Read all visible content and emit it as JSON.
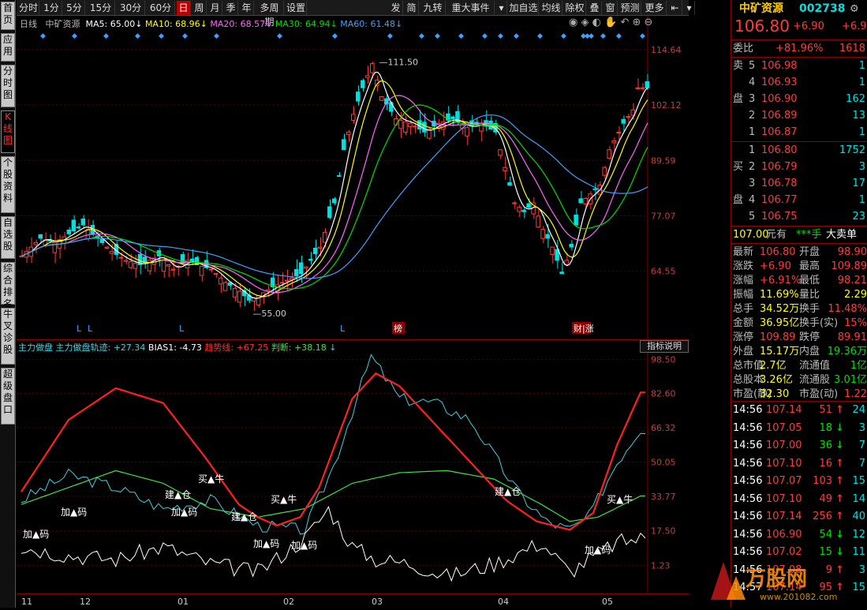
{
  "left_tabs": [
    "首页",
    "应用",
    "分时图",
    "K线图",
    "个股资料",
    "自选股",
    "综合排名",
    "牛叉诊股",
    "超级盘口"
  ],
  "left_tabs_active": 3,
  "toolbar": {
    "periods": [
      "分时",
      "1分",
      "5分",
      "15分",
      "30分",
      "60分",
      "日",
      "周",
      "月",
      "季",
      "年",
      "多周期",
      "设置"
    ],
    "active_period": "日",
    "right_items": [
      "发",
      "简",
      "九转",
      "重大事件",
      "▾",
      "加自选",
      "均线",
      "除权",
      "叠",
      "窗",
      "预测",
      "更多",
      "⇤",
      "▾"
    ]
  },
  "main_legend": {
    "period": "日线",
    "name": "中矿资源",
    "ma5": "MA5: 65.00",
    "ma10": "MA10: 68.96",
    "ma20": "MA20: 68.57",
    "ma30": "MA30: 64.94",
    "ma60": "MA60: 61.48",
    "high_label": "111.50",
    "low_label": "55.00",
    "markers": [
      "L",
      "L",
      "L",
      "L",
      "榜",
      "财|涨"
    ]
  },
  "price_axis": [
    "114.64",
    "102.12",
    "89.59",
    "77.07",
    "64.55"
  ],
  "sub_legend": {
    "name": "主力做盘",
    "track": "主力做盘轨迹: +27.34",
    "bias": "BIAS1: -4.73",
    "trend": "趋势线: +67.25",
    "judge": "判断: +38.18",
    "button": "指标说明"
  },
  "sub_axis": [
    "98.50",
    "82.60",
    "66.32",
    "50.05",
    "33.77",
    "17.50",
    "1.23"
  ],
  "sub_annotations": [
    "加▲码",
    "加▲码",
    "买▲牛",
    "建▲仓",
    "加▲码",
    "建▲仓",
    "加▲码",
    "加▲码",
    "买▲牛",
    "建▲仓",
    "买▲牛",
    "加▲码"
  ],
  "dates": [
    "11",
    "12",
    "01",
    "02",
    "03",
    "04",
    "05"
  ],
  "quote": {
    "name": "中矿资源",
    "code": "002738",
    "price": "106.80",
    "change": "+6.90",
    "change2": "+6.9",
    "weibi_label": "委比",
    "weibi": "+81.96%",
    "weicha": "1618",
    "sell_label": [
      "卖",
      "盘"
    ],
    "buy_label": [
      "买",
      "盘"
    ],
    "sells": [
      {
        "lvl": "5",
        "price": "106.98",
        "vol": "1"
      },
      {
        "lvl": "4",
        "price": "106.93",
        "vol": "1"
      },
      {
        "lvl": "3",
        "price": "106.90",
        "vol": "162"
      },
      {
        "lvl": "2",
        "price": "106.89",
        "vol": "13"
      },
      {
        "lvl": "1",
        "price": "106.87",
        "vol": "1"
      }
    ],
    "buys": [
      {
        "lvl": "1",
        "price": "106.80",
        "vol": "1752"
      },
      {
        "lvl": "2",
        "price": "106.79",
        "vol": "3"
      },
      {
        "lvl": "3",
        "price": "106.78",
        "vol": "17"
      },
      {
        "lvl": "4",
        "price": "106.77",
        "vol": "1"
      },
      {
        "lvl": "5",
        "price": "106.75",
        "vol": "23"
      }
    ],
    "big_order": {
      "price": "107.00",
      "unit": "元有",
      "hands": "***手",
      "label": "大卖单"
    },
    "stats": [
      [
        "最新",
        "106.80",
        "开盘",
        "98.90"
      ],
      [
        "涨跌",
        "+6.90",
        "最高",
        "109.89"
      ],
      [
        "涨幅",
        "+6.91%",
        "最低",
        "98.21"
      ],
      [
        "振幅",
        "11.69%",
        "量比",
        "2.29"
      ],
      [
        "总手",
        "34.52万",
        "换手",
        "11.48%"
      ],
      [
        "金额",
        "36.95亿",
        "换手(实)",
        "15%"
      ],
      [
        "涨停",
        "109.89",
        "跌停",
        "89.91"
      ],
      [
        "外盘",
        "15.17万",
        "内盘",
        "19.36万"
      ],
      [
        "总市值",
        "2.7亿",
        "流通值",
        "1亿"
      ],
      [
        "总股本",
        "3.26亿",
        "流通股",
        "3.01亿"
      ],
      [
        "市盈(静)",
        "32.30",
        "市盈(动)",
        "1.22"
      ]
    ],
    "ticks": [
      {
        "t": "14:56",
        "p": "107.14",
        "v": "51",
        "d": "up",
        "n": "24"
      },
      {
        "t": "14:56",
        "p": "107.05",
        "v": "18",
        "d": "down",
        "n": "3"
      },
      {
        "t": "14:56",
        "p": "107.00",
        "v": "36",
        "d": "down",
        "n": "7"
      },
      {
        "t": "14:56",
        "p": "107.10",
        "v": "16",
        "d": "up",
        "n": "7"
      },
      {
        "t": "14:56",
        "p": "107.07",
        "v": "103",
        "d": "up",
        "n": "15"
      },
      {
        "t": "14:56",
        "p": "107.10",
        "v": "49",
        "d": "up",
        "n": "14"
      },
      {
        "t": "14:56",
        "p": "107.14",
        "v": "256",
        "d": "up",
        "n": "40"
      },
      {
        "t": "14:56",
        "p": "106.90",
        "v": "54",
        "d": "down",
        "n": "12"
      },
      {
        "t": "14:56",
        "p": "107.02",
        "v": "15",
        "d": "down",
        "n": "11"
      },
      {
        "t": "14:56",
        "p": "107.08",
        "v": "9",
        "d": "up",
        "n": "3"
      },
      {
        "t": "14:57",
        "p": "107.14",
        "v": "95",
        "d": "up",
        "n": "15"
      }
    ]
  },
  "watermark": {
    "text": "万股网",
    "url": "www.201082.com"
  },
  "colors": {
    "up": "#ff3c3c",
    "down": "#00e0e0",
    "ma5": "#ffffff",
    "ma10": "#ffff00",
    "ma20": "#ff66ff",
    "ma30": "#00dd00",
    "ma60": "#3fa0ff",
    "trend": "#ff2020",
    "track": "#40d0e0",
    "judge": "#40e040",
    "bias": "#ffffff"
  }
}
